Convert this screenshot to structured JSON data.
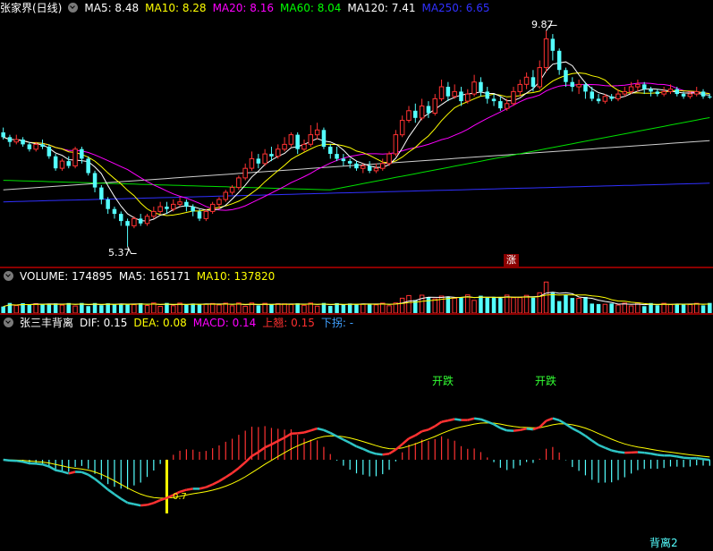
{
  "main": {
    "stock_name": "张家界(日线)",
    "ma_labels": [
      {
        "text": "MA5: 8.48",
        "color": "#ffffff"
      },
      {
        "text": "MA10: 8.28",
        "color": "#ffff00"
      },
      {
        "text": "MA20: 8.16",
        "color": "#ff00ff"
      },
      {
        "text": "MA60: 8.04",
        "color": "#00ff00"
      },
      {
        "text": "MA120: 7.41",
        "color": "#ffffff"
      },
      {
        "text": "MA250: 6.65",
        "color": "#3030ff"
      }
    ],
    "high_label": "9.87",
    "low_label": "5.37",
    "limit_badge": "涨"
  },
  "volume": {
    "labels": [
      {
        "text": "VOLUME: 174895",
        "color": "#ffffff"
      },
      {
        "text": "MA5: 165171",
        "color": "#ffffff"
      },
      {
        "text": "MA10: 137820",
        "color": "#ffff00"
      }
    ]
  },
  "indicator": {
    "labels": [
      {
        "text": "张三丰背离",
        "color": "#ffffff"
      },
      {
        "text": "DIF: 0.15",
        "color": "#ffffff"
      },
      {
        "text": "DEA: 0.08",
        "color": "#ffff00"
      },
      {
        "text": "MACD: 0.14",
        "color": "#ff00ff"
      },
      {
        "text": "上翘: 0.15",
        "color": "#ff3030"
      },
      {
        "text": "下拐: -",
        "color": "#40a0ff"
      }
    ],
    "annotations": [
      {
        "text": "开跌",
        "color": "#33ff33"
      },
      {
        "text": "开跌",
        "color": "#33ff33"
      }
    ],
    "bottom_label": "背离2",
    "small_value": "0.7"
  },
  "colors": {
    "up": "#ff3232",
    "down": "#54ffff",
    "separator": "#8b0000"
  },
  "candles": [
    [
      7.75,
      7.65,
      7.85,
      7.6
    ],
    [
      7.65,
      7.55,
      7.7,
      7.45
    ],
    [
      7.55,
      7.6,
      7.7,
      7.5
    ],
    [
      7.6,
      7.5,
      7.65,
      7.45
    ],
    [
      7.5,
      7.4,
      7.55,
      7.35
    ],
    [
      7.4,
      7.5,
      7.55,
      7.35
    ],
    [
      7.5,
      7.45,
      7.6,
      7.4
    ],
    [
      7.45,
      7.25,
      7.5,
      7.2
    ],
    [
      7.25,
      7.0,
      7.3,
      6.95
    ],
    [
      7.0,
      7.15,
      7.2,
      6.95
    ],
    [
      7.15,
      7.05,
      7.25,
      7.0
    ],
    [
      7.05,
      7.4,
      7.45,
      7.0
    ],
    [
      7.4,
      7.2,
      7.45,
      7.1
    ],
    [
      7.2,
      6.9,
      7.25,
      6.85
    ],
    [
      6.9,
      6.6,
      6.95,
      6.5
    ],
    [
      6.6,
      6.35,
      6.65,
      6.25
    ],
    [
      6.35,
      6.15,
      6.4,
      6.05
    ],
    [
      6.15,
      6.05,
      6.2,
      5.95
    ],
    [
      6.05,
      5.9,
      6.1,
      5.8
    ],
    [
      5.9,
      5.8,
      5.95,
      5.37
    ],
    [
      5.8,
      5.95,
      6.0,
      5.75
    ],
    [
      5.95,
      5.85,
      6.05,
      5.8
    ],
    [
      5.85,
      6.0,
      6.05,
      5.8
    ],
    [
      6.0,
      6.1,
      6.2,
      5.95
    ],
    [
      6.1,
      6.2,
      6.3,
      6.05
    ],
    [
      6.2,
      6.15,
      6.3,
      6.05
    ],
    [
      6.15,
      6.25,
      6.35,
      6.1
    ],
    [
      6.25,
      6.3,
      6.4,
      6.2
    ],
    [
      6.3,
      6.2,
      6.35,
      6.1
    ],
    [
      6.2,
      6.1,
      6.25,
      6.0
    ],
    [
      6.1,
      5.95,
      6.15,
      5.9
    ],
    [
      5.95,
      6.1,
      6.15,
      5.9
    ],
    [
      6.1,
      6.25,
      6.3,
      6.05
    ],
    [
      6.25,
      6.35,
      6.4,
      6.15
    ],
    [
      6.35,
      6.5,
      6.55,
      6.3
    ],
    [
      6.5,
      6.6,
      6.65,
      6.45
    ],
    [
      6.6,
      6.8,
      6.85,
      6.55
    ],
    [
      6.8,
      7.0,
      7.1,
      6.75
    ],
    [
      7.0,
      7.2,
      7.35,
      6.95
    ],
    [
      7.2,
      7.1,
      7.3,
      7.0
    ],
    [
      7.1,
      7.3,
      7.4,
      7.05
    ],
    [
      7.3,
      7.25,
      7.45,
      7.15
    ],
    [
      7.25,
      7.4,
      7.5,
      7.2
    ],
    [
      7.4,
      7.5,
      7.65,
      7.35
    ],
    [
      7.5,
      7.7,
      7.75,
      7.45
    ],
    [
      7.7,
      7.4,
      7.75,
      7.3
    ],
    [
      7.4,
      7.5,
      7.6,
      7.35
    ],
    [
      7.5,
      7.7,
      7.9,
      7.45
    ],
    [
      7.7,
      7.8,
      7.95,
      7.6
    ],
    [
      7.8,
      7.45,
      7.85,
      7.4
    ],
    [
      7.45,
      7.3,
      7.5,
      7.2
    ],
    [
      7.3,
      7.2,
      7.45,
      7.15
    ],
    [
      7.2,
      7.15,
      7.3,
      7.05
    ],
    [
      7.15,
      7.1,
      7.2,
      7.0
    ],
    [
      7.1,
      7.0,
      7.15,
      6.95
    ],
    [
      7.0,
      7.05,
      7.1,
      6.9
    ],
    [
      7.05,
      6.95,
      7.15,
      6.9
    ],
    [
      6.95,
      7.0,
      7.1,
      6.9
    ],
    [
      7.0,
      7.1,
      7.2,
      6.95
    ],
    [
      7.1,
      7.3,
      7.35,
      7.05
    ],
    [
      7.3,
      7.7,
      7.8,
      7.25
    ],
    [
      7.7,
      8.0,
      8.1,
      7.65
    ],
    [
      8.0,
      8.2,
      8.3,
      7.95
    ],
    [
      8.2,
      8.05,
      8.35,
      7.95
    ],
    [
      8.05,
      8.3,
      8.45,
      8.0
    ],
    [
      8.3,
      8.15,
      8.4,
      8.05
    ],
    [
      8.15,
      8.45,
      8.55,
      8.1
    ],
    [
      8.45,
      8.7,
      8.85,
      8.4
    ],
    [
      8.7,
      8.5,
      8.8,
      8.4
    ],
    [
      8.5,
      8.6,
      8.75,
      8.45
    ],
    [
      8.6,
      8.4,
      8.7,
      8.3
    ],
    [
      8.4,
      8.55,
      8.65,
      8.35
    ],
    [
      8.55,
      8.8,
      8.95,
      8.5
    ],
    [
      8.8,
      8.6,
      8.9,
      8.5
    ],
    [
      8.6,
      8.45,
      8.7,
      8.35
    ],
    [
      8.45,
      8.4,
      8.55,
      8.3
    ],
    [
      8.4,
      8.25,
      8.5,
      8.2
    ],
    [
      8.25,
      8.35,
      8.45,
      8.2
    ],
    [
      8.35,
      8.6,
      8.7,
      8.3
    ],
    [
      8.6,
      8.75,
      8.85,
      8.5
    ],
    [
      8.75,
      8.9,
      9.0,
      8.65
    ],
    [
      8.9,
      8.7,
      9.05,
      8.6
    ],
    [
      8.7,
      9.1,
      9.25,
      8.65
    ],
    [
      9.1,
      9.7,
      9.87,
      9.0
    ],
    [
      9.7,
      9.45,
      9.8,
      9.25
    ],
    [
      9.45,
      9.05,
      9.5,
      8.95
    ],
    [
      9.05,
      8.8,
      9.1,
      8.7
    ],
    [
      8.8,
      8.7,
      8.9,
      8.6
    ],
    [
      8.7,
      8.75,
      8.85,
      8.55
    ],
    [
      8.75,
      8.6,
      8.8,
      8.45
    ],
    [
      8.6,
      8.45,
      8.7,
      8.4
    ],
    [
      8.45,
      8.4,
      8.55,
      8.35
    ],
    [
      8.4,
      8.5,
      8.55,
      8.35
    ],
    [
      8.5,
      8.45,
      8.55,
      8.4
    ],
    [
      8.45,
      8.55,
      8.65,
      8.4
    ],
    [
      8.55,
      8.6,
      8.7,
      8.5
    ],
    [
      8.6,
      8.7,
      8.8,
      8.55
    ],
    [
      8.7,
      8.75,
      8.85,
      8.6
    ],
    [
      8.75,
      8.65,
      8.8,
      8.55
    ],
    [
      8.65,
      8.6,
      8.7,
      8.5
    ],
    [
      8.6,
      8.55,
      8.65,
      8.5
    ],
    [
      8.55,
      8.6,
      8.7,
      8.5
    ],
    [
      8.6,
      8.65,
      8.75,
      8.55
    ],
    [
      8.65,
      8.55,
      8.7,
      8.5
    ],
    [
      8.55,
      8.5,
      8.6,
      8.45
    ],
    [
      8.5,
      8.55,
      8.6,
      8.45
    ],
    [
      8.55,
      8.6,
      8.7,
      8.5
    ],
    [
      8.6,
      8.5,
      8.65,
      8.45
    ],
    [
      8.5,
      8.48,
      8.55,
      8.45
    ]
  ]
}
